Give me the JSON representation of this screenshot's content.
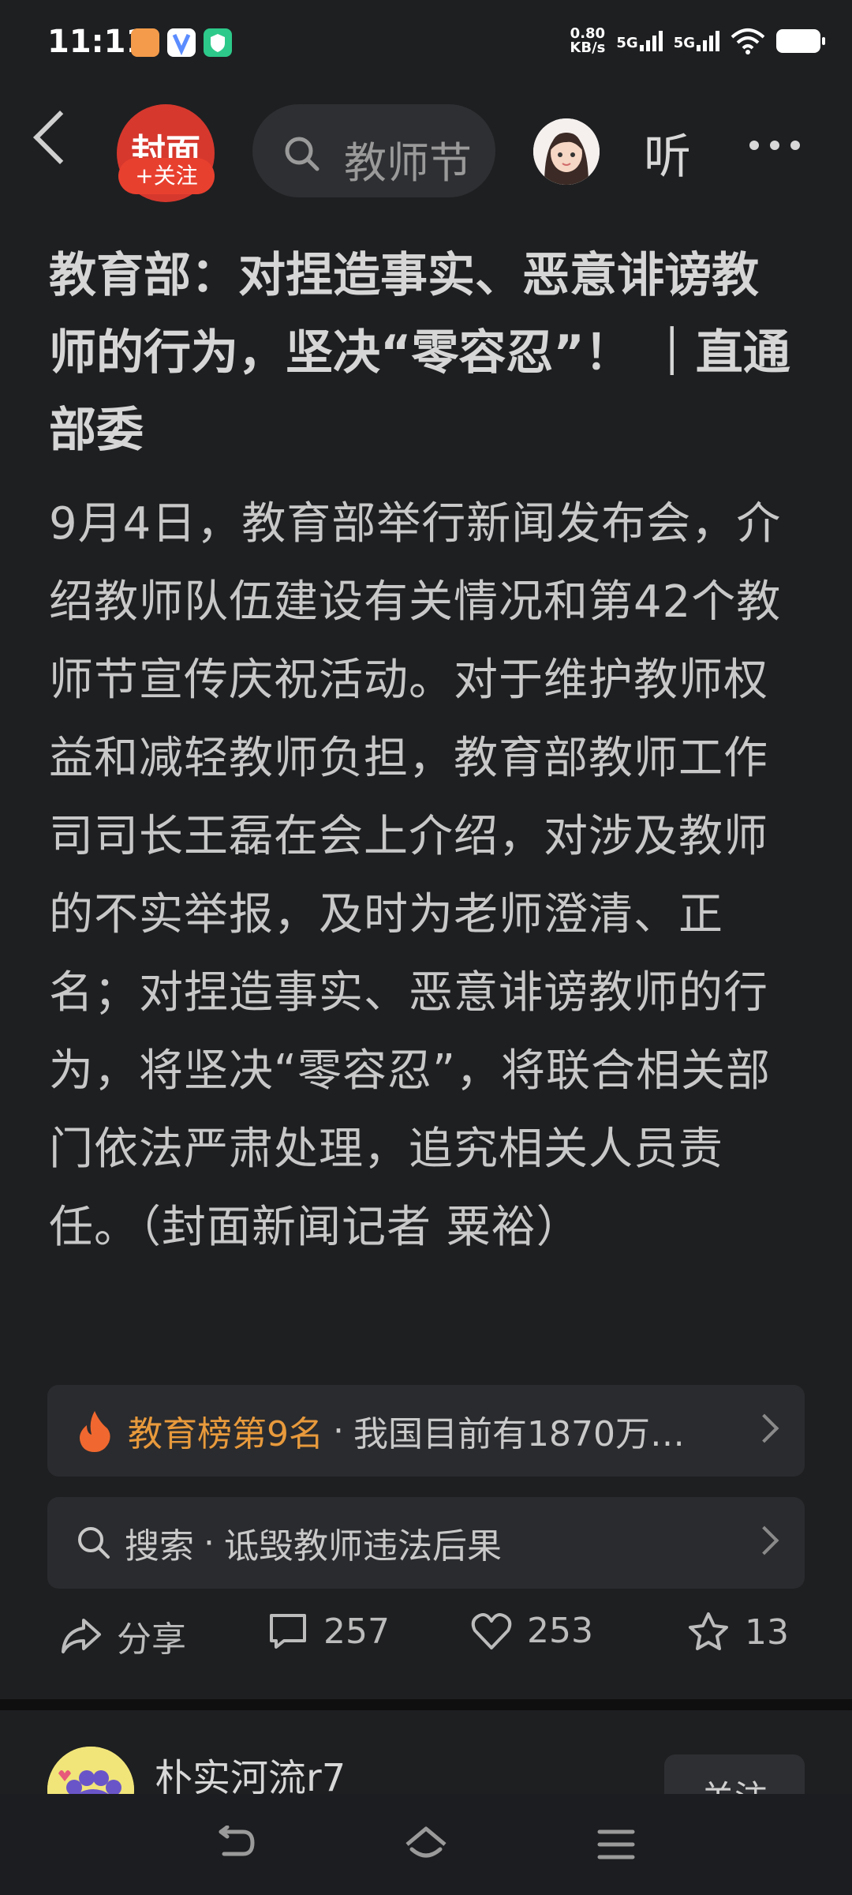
{
  "status_bar": {
    "time": "11:11",
    "net_speed_value": "0.80",
    "net_speed_unit": "KB/s",
    "sim1": "5G",
    "sim2": "5G"
  },
  "header": {
    "logo_text": "封面",
    "follow_badge": "+关注",
    "search_text": "教师节",
    "listen_label": "听"
  },
  "article": {
    "title": "教育部：对捏造事实、恶意诽谤教师的行为，坚决“零容忍”！ ｜直通部委",
    "body": "9月4日，教育部举行新闻发布会，介绍教师队伍建设有关情况和第42个教师节宣传庆祝活动。对于维护教师权益和减轻教师负担，教育部教师工作司司长王磊在会上介绍，对涉及教师的不实举报，及时为老师澄清、正名；对捏造事实、恶意诽谤教师的行为，将坚决“零容忍”，将联合相关部门依法严肃处理，追究相关人员责任。（封面新闻记者 粟裕）"
  },
  "hot_rank": {
    "rank_label": "教育榜第9名",
    "separator": "·",
    "text": "我国目前有1870万…"
  },
  "search_suggest": {
    "label": "搜索",
    "separator": "·",
    "query": "诋毁教师违法后果"
  },
  "actions": {
    "share": "分享",
    "comments": "257",
    "likes": "253",
    "favorites": "13"
  },
  "comment": {
    "username": "朴实河流r7",
    "follow_label": "关注"
  },
  "colors": {
    "background": "#1e1f21",
    "accent_red": "#e8402f",
    "rank_orange": "#e89a3c"
  }
}
